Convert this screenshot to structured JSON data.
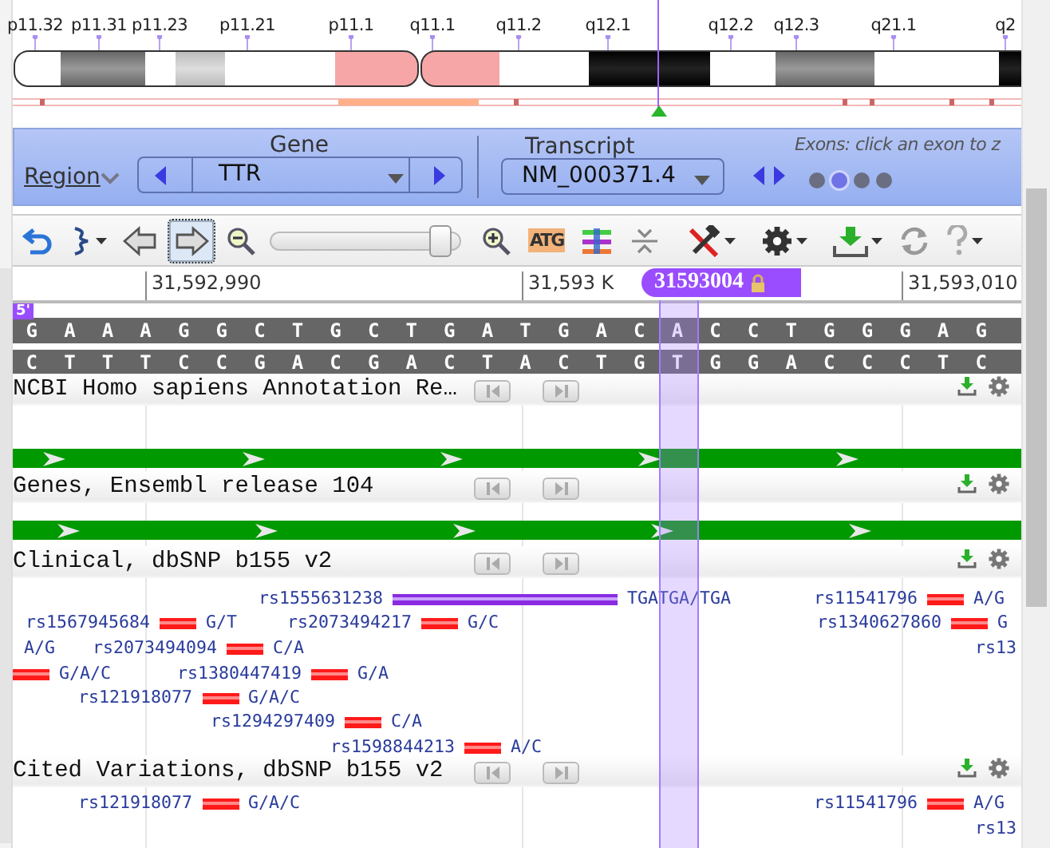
{
  "ideogram": {
    "bands": [
      "p11.32",
      "p11.31",
      "p11.23",
      "p11.21",
      "p11.1",
      "q11.1",
      "q11.2",
      "q12.1",
      "q12.2",
      "q12.3",
      "q21.1",
      "q2"
    ]
  },
  "gene_bar": {
    "region_link": "Region",
    "gene_label": "Gene",
    "gene_value": "TTR",
    "transcript_label": "Transcript",
    "transcript_value": "NM_000371.4",
    "exons_hint": "Exons: click an exon to z",
    "exons": [
      {
        "selected": false
      },
      {
        "selected": true
      },
      {
        "selected": false
      },
      {
        "selected": false
      }
    ]
  },
  "toolbar": [
    {
      "kind": "undo",
      "selected": false
    },
    {
      "kind": "flip",
      "selected": false,
      "menu": true
    },
    {
      "kind": "pan-left",
      "selected": false
    },
    {
      "kind": "pan-right",
      "selected": true
    },
    {
      "kind": "zoom-out",
      "selected": false
    },
    {
      "kind": "zoom-slider",
      "level": 0.93
    },
    {
      "kind": "zoom-in",
      "selected": false
    },
    {
      "kind": "sequence",
      "label": "ATG",
      "selected": false
    },
    {
      "kind": "tracks",
      "selected": false
    },
    {
      "kind": "collapse",
      "selected": false
    },
    {
      "kind": "tools",
      "selected": false,
      "menu": true
    },
    {
      "kind": "settings",
      "selected": false,
      "menu": true
    },
    {
      "kind": "download",
      "selected": false,
      "menu": true
    },
    {
      "kind": "refresh",
      "selected": false
    },
    {
      "kind": "help",
      "selected": false,
      "menu": true
    }
  ],
  "ruler": {
    "ticks": [
      "31,592,990",
      "31,593 K",
      "31,593,010"
    ],
    "marker": "31593004",
    "strand_badge": "5'"
  },
  "sequence": {
    "forward": [
      "G",
      "A",
      "A",
      "A",
      "G",
      "G",
      "C",
      "T",
      "G",
      "C",
      "T",
      "G",
      "A",
      "T",
      "G",
      "A",
      "C",
      "A",
      "C",
      "C",
      "T",
      "G",
      "G",
      "G",
      "A",
      "G"
    ],
    "reverse": [
      "C",
      "T",
      "T",
      "T",
      "C",
      "C",
      "G",
      "A",
      "C",
      "G",
      "A",
      "C",
      "T",
      "A",
      "C",
      "T",
      "G",
      "T",
      "G",
      "G",
      "A",
      "C",
      "C",
      "C",
      "T",
      "C"
    ]
  },
  "tracks": [
    {
      "kind": "gene",
      "title": "NCBI Homo sapiens Annotation Re…"
    },
    {
      "kind": "gene",
      "title": "Genes, Ensembl release 104"
    },
    {
      "kind": "variants",
      "title": "Clinical, dbSNP b155 v2",
      "lanes": [
        {
          "variants": [
            {
              "kind": "indel",
              "id": "rs1555631238",
              "allele": "TGATGA/TGA"
            },
            {
              "kind": "snv",
              "id": "rs11541796",
              "allele": "A/G"
            }
          ]
        },
        {
          "variants": [
            {
              "kind": "snv",
              "id": "rs1567945684",
              "allele": "G/T"
            },
            {
              "kind": "snv",
              "id": "rs2073494217",
              "allele": "G/C"
            },
            {
              "kind": "snv",
              "id": "rs1340627860",
              "allele": "G"
            }
          ]
        },
        {
          "variants": [
            {
              "kind": "partial",
              "allele": "A/G"
            },
            {
              "kind": "snv",
              "id": "rs2073494094",
              "allele": "C/A"
            },
            {
              "kind": "partial",
              "id": "rs13"
            }
          ]
        },
        {
          "variants": [
            {
              "kind": "snv",
              "allele": "G/A/C"
            },
            {
              "kind": "snv",
              "id": "rs1380447419",
              "allele": "G/A"
            }
          ]
        },
        {
          "variants": [
            {
              "kind": "snv",
              "id": "rs121918077",
              "allele": "G/A/C"
            }
          ]
        },
        {
          "variants": [
            {
              "kind": "snv",
              "id": "rs1294297409",
              "allele": "C/A"
            }
          ]
        },
        {
          "variants": [
            {
              "kind": "snv",
              "id": "rs1598844213",
              "allele": "A/C"
            }
          ]
        }
      ]
    },
    {
      "kind": "variants",
      "title": "Cited Variations, dbSNP b155 v2",
      "lanes": [
        {
          "variants": [
            {
              "kind": "snv",
              "id": "rs121918077",
              "allele": "G/A/C"
            },
            {
              "kind": "snv",
              "id": "rs11541796",
              "allele": "A/G"
            }
          ]
        },
        {
          "variants": [
            {
              "kind": "partial",
              "id": "rs13"
            }
          ]
        }
      ]
    }
  ]
}
